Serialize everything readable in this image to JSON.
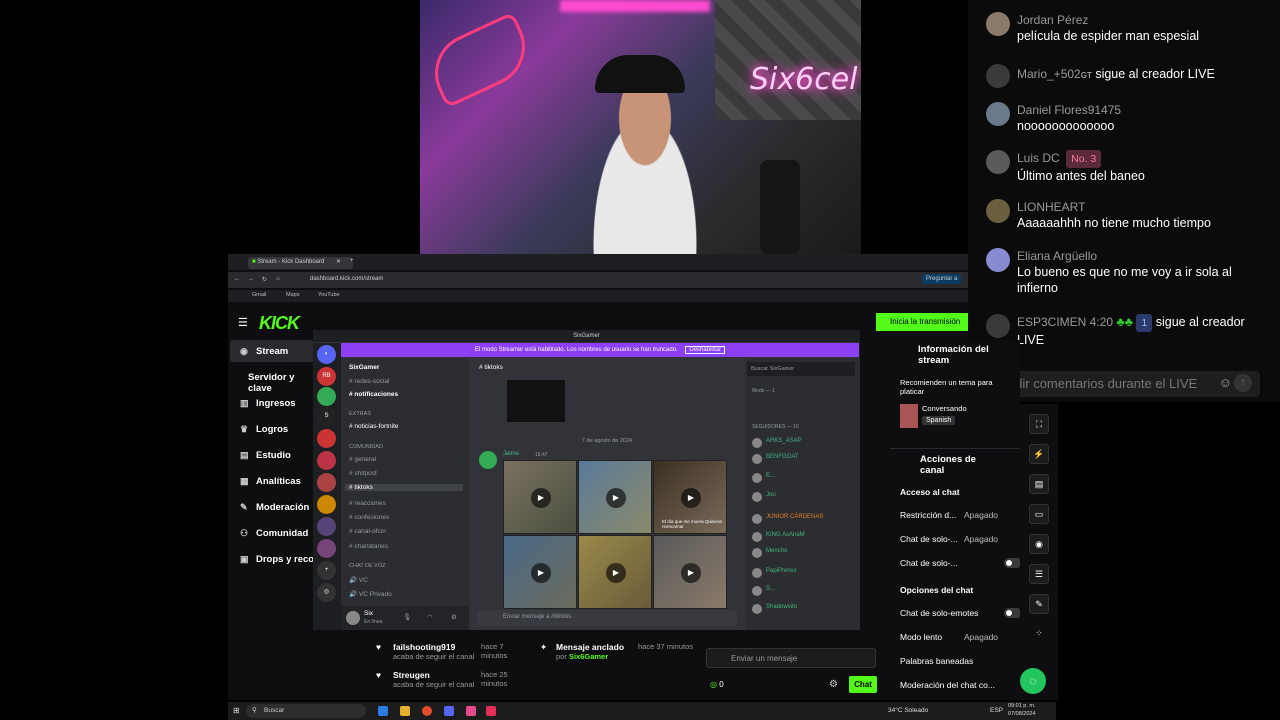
{
  "chat": {
    "messages": [
      {
        "name": "Jordan Pérez",
        "text": "película de espider man espesial"
      },
      {
        "name": "Mario_+502",
        "suffix": "GT",
        "text": "sigue al creador LIVE",
        "inline": true
      },
      {
        "name": "Daniel Flores91475",
        "text": "nooooooooooooo"
      },
      {
        "name": "Luis DC",
        "badge": "No. 3",
        "text": "Último antes del baneo"
      },
      {
        "name": "LIONHEART",
        "text": "Aaaaaahhh no tiene mucho tiempo"
      },
      {
        "name": "Eliana Argüello",
        "text": "Lo bueno es que no me voy a ir sola al infierno"
      },
      {
        "name": "ESP3CIMEN 4:20",
        "badge": "1",
        "text": "sigue al creador LIVE",
        "inline": true
      }
    ],
    "input_placeholder": "Añadir comentarios durante el LIVE"
  },
  "webcam": {
    "neon_text": "Six6cel"
  },
  "browser": {
    "tab_title": "Stream - Kick Dashboard",
    "url": "dashboard.kick.com/stream",
    "bookmarks": [
      "Gmail",
      "Maps",
      "YouTube"
    ],
    "ask_label": "Preguntar a"
  },
  "kick": {
    "logo": "KICK",
    "start_button": "Inicia la transmisión",
    "nav": [
      {
        "label": "Stream",
        "icon": "◉"
      },
      {
        "label": "Servidor y clave",
        "icon": ""
      },
      {
        "label": "Ingresos",
        "icon": "▥"
      },
      {
        "label": "Logros",
        "icon": "♛"
      },
      {
        "label": "Estudio",
        "icon": "▤"
      },
      {
        "label": "Analíticas",
        "icon": "▦"
      },
      {
        "label": "Moderación",
        "icon": "✎"
      },
      {
        "label": "Comunidad",
        "icon": "⚇"
      },
      {
        "label": "Drops y recompensas",
        "icon": "▣"
      }
    ],
    "info": {
      "title": "Información del stream",
      "recommended": "Recomienden un tema para platicar",
      "category": "Conversando",
      "language": "Spanish"
    },
    "actions": {
      "title": "Acciones de canal",
      "chat_access": "Acceso al chat",
      "restriction_label": "Restricción d...",
      "restriction_value": "Apagado",
      "solo_chat_label": "Chat de solo-...",
      "solo_chat_value": "Apagado",
      "solo_chat2_label": "Chat de solo-...",
      "chat_options": "Opciones del chat",
      "emotes_label": "Chat de solo-emotes",
      "slow_label": "Modo lento",
      "slow_value": "Apagado",
      "banned_words": "Palabras baneadas",
      "moderation_label": "Moderación del chat co..."
    },
    "activity": [
      {
        "name": "failshooting919",
        "sub": "acaba de seguir el canal",
        "time": "hace 7 minutos"
      },
      {
        "name": "Streugen",
        "sub": "acaba de seguir el canal",
        "time": "hace 25 minutos"
      }
    ],
    "pinned": {
      "title": "Mensaje anclado",
      "by": "por",
      "user": "Six6Gamer",
      "time": "hace 37 minutos"
    },
    "chat_placeholder": "Enviar un mensaje",
    "chat_count": "0",
    "chat_button": "Chat"
  },
  "discord": {
    "title": "SixGamer",
    "banner": "El modo Streamer está habilitado. Los nombres de usuario se han truncado.",
    "banner_button": "Deshabilitar",
    "server_name": "SixGamer",
    "channel_title": "tiktoks",
    "search_placeholder": "Buscar SixGamer",
    "channels": [
      "redes-social",
      "notificaciones",
      "EXTRAS",
      "noticias-fortnite",
      "COMUNIDAD",
      "general",
      "shitpost",
      "tiktoks",
      "reacciones",
      "confesiones",
      "canal-ofcin",
      "charlatanes",
      "CHAT DE VOZ",
      "VC",
      "VC Privado"
    ],
    "date_divider": "7 de agosto de 2024",
    "author": "Jaime",
    "author_time": "16:47",
    "caption": "El día que me muera Quisiera reencarnar",
    "message_placeholder": "Enviar mensaje a #tiktoks",
    "members_header": "SEGUIDORES — 10",
    "mods_header": "Mods — 1",
    "members": [
      "ARKS_ASAP",
      "BENFGOAT",
      "E...",
      "Jou",
      "JUNIOR CÁRDENAS",
      "KING AsAnaM",
      "Mencho",
      "PapiPrenxx",
      "S...",
      "Shadowsito"
    ],
    "user_name": "Six",
    "user_status": "En línea"
  },
  "taskbar": {
    "search": "Buscar",
    "weather": "34°C Soleado",
    "lang": "ESP",
    "time": "09:01 p. m.",
    "date": "07/08/2024"
  }
}
